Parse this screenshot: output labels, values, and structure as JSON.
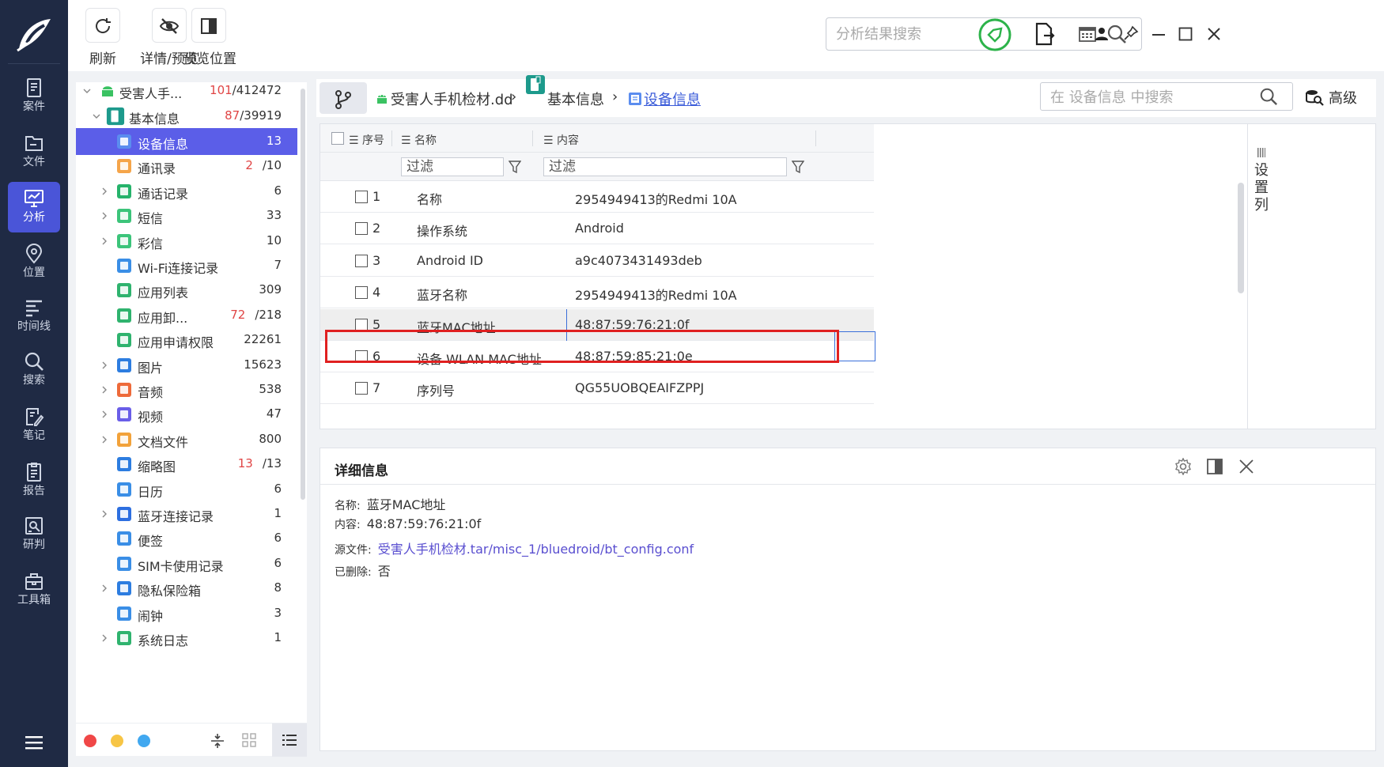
{
  "nav": {
    "items": [
      {
        "label": "案件",
        "icon": "case-icon"
      },
      {
        "label": "文件",
        "icon": "folder-icon"
      },
      {
        "label": "分析",
        "icon": "analysis-icon"
      },
      {
        "label": "位置",
        "icon": "location-icon"
      },
      {
        "label": "时间线",
        "icon": "timeline-icon"
      },
      {
        "label": "搜索",
        "icon": "search-icon"
      },
      {
        "label": "笔记",
        "icon": "note-icon"
      },
      {
        "label": "报告",
        "icon": "report-icon"
      },
      {
        "label": "研判",
        "icon": "judge-icon"
      },
      {
        "label": "工具箱",
        "icon": "toolbox-icon"
      }
    ],
    "active_index": 2,
    "accent": "#4a55d8",
    "bg": "#1f2a44"
  },
  "toolbar": {
    "refresh_label": "刷新",
    "detail_preview_label": "详情/预览",
    "preview_position_label": "预览位置",
    "search_placeholder": "分析结果搜索"
  },
  "tree": {
    "root": {
      "name": "受害人手...",
      "count_red": "101",
      "count_total": "/412472"
    },
    "group": {
      "name": "基本信息",
      "count_red": "87",
      "count_total": "/39919"
    },
    "items": [
      {
        "name": "设备信息",
        "count": "13",
        "selected": true,
        "icon": "device-info-icon",
        "color": "#5b8def"
      },
      {
        "name": "通讯录",
        "count_red": "2",
        "count": "/10",
        "icon": "contacts-icon",
        "color": "#f5a54a"
      },
      {
        "name": "通话记录",
        "count": "6",
        "icon": "call-log-icon",
        "color": "#26b36b",
        "expandable": true
      },
      {
        "name": "短信",
        "count": "33",
        "icon": "sms-icon",
        "color": "#3cc47a",
        "expandable": true
      },
      {
        "name": "彩信",
        "count": "10",
        "icon": "mms-icon",
        "color": "#3cc47a",
        "expandable": true
      },
      {
        "name": "Wi-Fi连接记录",
        "count": "7",
        "icon": "wifi-icon",
        "color": "#3a8ee6"
      },
      {
        "name": "应用列表",
        "count": "309",
        "icon": "app-list-icon",
        "color": "#2fb36e"
      },
      {
        "name": "应用卸...",
        "count_red": "72",
        "count": "/218",
        "icon": "app-uninstall-icon",
        "color": "#2fb36e"
      },
      {
        "name": "应用申请权限",
        "count": "22261",
        "icon": "app-permission-icon",
        "color": "#2fb36e"
      },
      {
        "name": "图片",
        "count": "15623",
        "icon": "image-icon",
        "color": "#2d7de0",
        "expandable": true
      },
      {
        "name": "音频",
        "count": "538",
        "icon": "audio-icon",
        "color": "#ee6a3a",
        "expandable": true
      },
      {
        "name": "视频",
        "count": "47",
        "icon": "video-icon",
        "color": "#6a5ee8",
        "expandable": true
      },
      {
        "name": "文档文件",
        "count": "800",
        "icon": "document-icon",
        "color": "#f2a23a",
        "expandable": true
      },
      {
        "name": "缩略图",
        "count_red": "13",
        "count": "/13",
        "icon": "thumbnail-icon",
        "color": "#2d7de0"
      },
      {
        "name": "日历",
        "count": "6",
        "icon": "calendar-icon",
        "color": "#3a8ee6"
      },
      {
        "name": "蓝牙连接记录",
        "count": "1",
        "icon": "bluetooth-icon",
        "color": "#2d6fe0",
        "expandable": true
      },
      {
        "name": "便签",
        "count": "6",
        "icon": "memo-icon",
        "color": "#3a8ee6"
      },
      {
        "name": "SIM卡使用记录",
        "count": "6",
        "icon": "sim-icon",
        "color": "#3a8ee6"
      },
      {
        "name": "隐私保险箱",
        "count": "8",
        "icon": "vault-icon",
        "color": "#2d7de0",
        "expandable": true
      },
      {
        "name": "闹钟",
        "count": "3",
        "icon": "alarm-icon",
        "color": "#3a8ee6"
      },
      {
        "name": "系统日志",
        "count": "1",
        "icon": "syslog-icon",
        "color": "#2fb36e",
        "expandable": true
      }
    ],
    "dots": [
      "#f04747",
      "#f7c545",
      "#41a8f0"
    ]
  },
  "crumbs": {
    "file": "受害人手机检材.dd",
    "group": "基本信息",
    "current": "设备信息",
    "search_placeholder": "在 设备信息 中搜索",
    "advanced_label": "高级"
  },
  "table": {
    "headers": {
      "no": "序号",
      "name": "名称",
      "content": "内容"
    },
    "filter_label": "过滤",
    "rows": [
      {
        "no": "1",
        "name": "名称",
        "content": "2954949413的Redmi 10A"
      },
      {
        "no": "2",
        "name": "操作系统",
        "content": "Android"
      },
      {
        "no": "3",
        "name": "Android ID",
        "content": "a9c4073431493deb"
      },
      {
        "no": "4",
        "name": "蓝牙名称",
        "content": "2954949413的Redmi 10A"
      },
      {
        "no": "5",
        "name": "蓝牙MAC地址",
        "content": "48:87:59:76:21:0f"
      },
      {
        "no": "6",
        "name": "设备 WLAN MAC地址",
        "content": "48:87:59:85:21:0e"
      },
      {
        "no": "7",
        "name": "序列号",
        "content": "QG55UOBQEAIFZPPJ"
      }
    ],
    "selected_index": 4,
    "column_settings_label": "设置列"
  },
  "detail": {
    "title": "详细信息",
    "fields": [
      {
        "key": "名称:",
        "value": "蓝牙MAC地址"
      },
      {
        "key": "内容:",
        "value": "48:87:59:76:21:0f"
      },
      {
        "key": "源文件:",
        "value": "受害人手机检材.tar/misc_1/bluedroid/bt_config.conf",
        "link": true
      },
      {
        "key": "已删除:",
        "value": "否"
      }
    ]
  }
}
